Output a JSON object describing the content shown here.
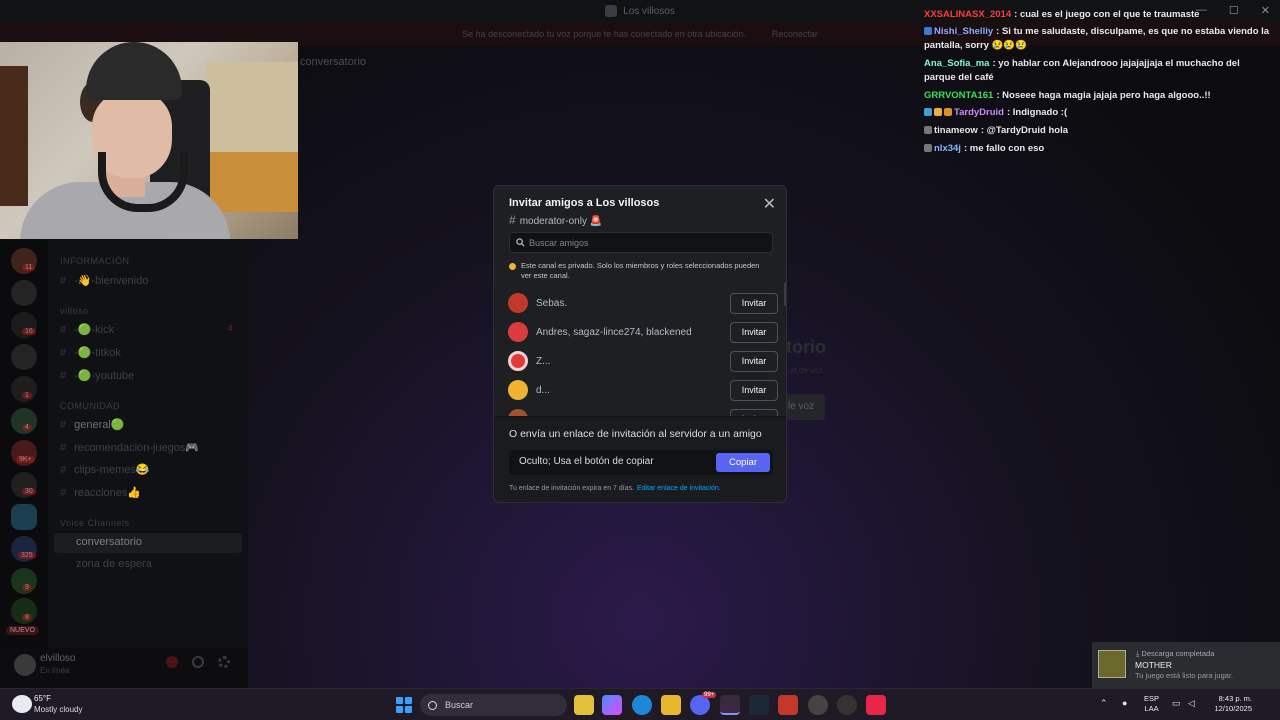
{
  "window": {
    "title": "Los villosos",
    "controls": [
      "—",
      "☐",
      "✕"
    ]
  },
  "banner": {
    "message": "Se ha desconectado tu voz porque te has conectado en otra ubicación.",
    "action": "Reconectar"
  },
  "server_badges": [
    "11",
    "16",
    "1",
    "4",
    "9K+",
    "30",
    "325",
    "9",
    "8"
  ],
  "server_new_label": "NUEVO",
  "channels": {
    "cat_info": "INFORMACIÓN",
    "bienvenido": "-👋-bienvenido",
    "cat_villoso": "villoso",
    "kick": "-🟢-kick",
    "kick_badge": "4",
    "tiktok": "-🟢-titkok",
    "youtube": "-🟢-youtube",
    "cat_comunidad": "COMUNIDAD",
    "general": "general🟢",
    "recomendacion": "recomendacion-juegos🎮",
    "clips": "clips-memes😂",
    "reacciones": "reacciones👍",
    "cat_voice": "Voice Channels",
    "conversatorio": "conversatorio",
    "zona": "zona de espera"
  },
  "user": {
    "name": "elvilloso",
    "status": "En línea"
  },
  "voice_header": "conversatorio",
  "background": {
    "title": "torio",
    "sub": "at de voz.",
    "button": "le voz"
  },
  "chat": [
    {
      "user": "XXSALINASX_2014",
      "color": "#ff3c3c",
      "text": "cual es el juego con el que te traumaste"
    },
    {
      "user": "Nishi_Shelliy",
      "color": "#8fa8ff",
      "text": "Si tu me saludaste, disculpame, es que no estaba viendo la pantalla, sorry 😢😢😢"
    },
    {
      "user": "Ana_Sofia_ma",
      "color": "#7cffc8",
      "text": "yo hablar con Alejandrooo jajajajjaja el muchacho del parque del café"
    },
    {
      "user": "GRRVONTA161",
      "color": "#37e05a",
      "text": "Noseee haga magia jajaja pero haga algooo..!!"
    },
    {
      "user": "TardyDruid",
      "color": "#c78bff",
      "text": "Indignado :("
    },
    {
      "user": "tinameow",
      "color": "#e6e6e6",
      "text": "@TardyDruid hola"
    },
    {
      "user": "nlx34j",
      "color": "#8ab4ff",
      "text": "me fallo con eso"
    }
  ],
  "modal": {
    "title": "Invitar amigos a Los villosos",
    "channel": "moderator-only 🚨",
    "search_placeholder": "Buscar amigos",
    "notice": "Este canal es privado. Solo los miembros y roles seleccionados pueden ver este canal.",
    "invite_label": "Invitar",
    "friends": [
      {
        "name": "Sebas.",
        "avatar_color": "#c0392b"
      },
      {
        "name": "Andres, sagaz-lince274, blackened",
        "avatar_color": "#d83c3e"
      },
      {
        "name": "Z...",
        "avatar_color": "#e23b3b"
      },
      {
        "name": "d...",
        "avatar_color": "#f0b232"
      },
      {
        "name": "",
        "avatar_color": "#a0522d"
      }
    ],
    "link_heading": "O envía un enlace de invitación al servidor a un amigo",
    "link_value": "Oculto; Usa el botón de copiar",
    "copy_label": "Copiar",
    "expiry": "Tu enlace de invitación expira en 7 días.",
    "edit_link": "Editar enlace de invitación."
  },
  "toast": {
    "heading": "Descarga completada",
    "game": "MOTHER",
    "sub": "Tu juego está listo para jugar."
  },
  "taskbar": {
    "temp": "65°F",
    "condition": "Mostly cloudy",
    "search": "Buscar",
    "lang_top": "ESP",
    "lang_bottom": "LAA",
    "time": "8:43 p. m.",
    "date": "12/10/2025",
    "discord_badge": "99+"
  }
}
